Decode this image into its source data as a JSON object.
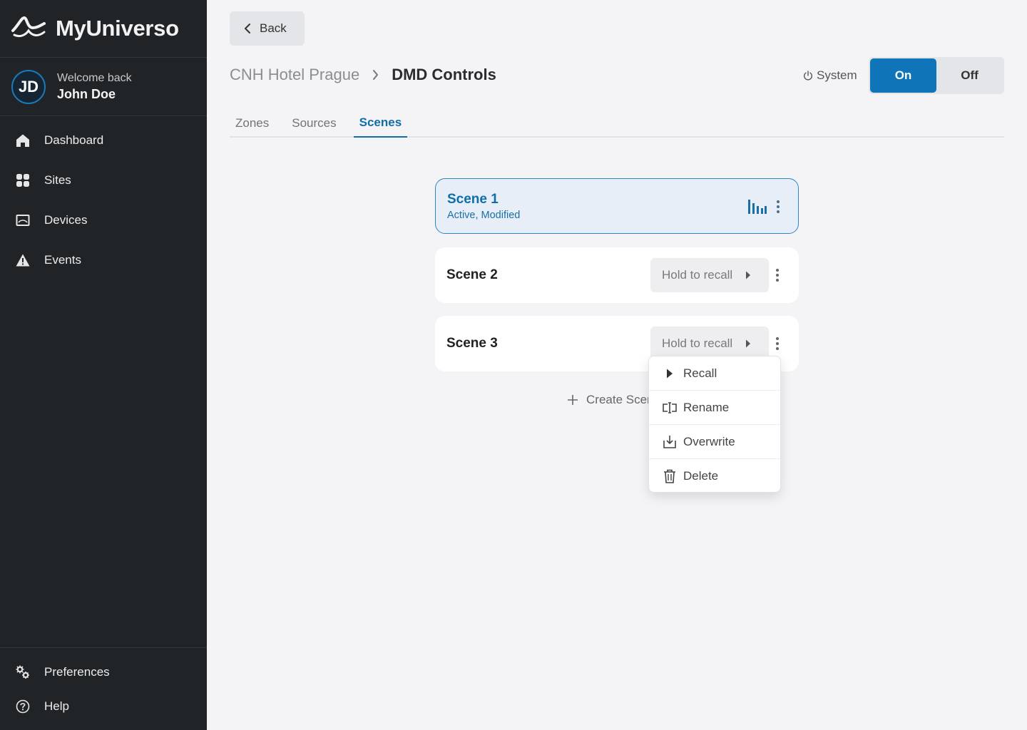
{
  "brand": {
    "name": "MyUniverso"
  },
  "user": {
    "initials": "JD",
    "welcome": "Welcome back",
    "name": "John Doe"
  },
  "nav": {
    "items": [
      {
        "label": "Dashboard",
        "icon": "home-icon"
      },
      {
        "label": "Sites",
        "icon": "grid-icon"
      },
      {
        "label": "Devices",
        "icon": "device-icon"
      },
      {
        "label": "Events",
        "icon": "warning-icon"
      }
    ],
    "bottom": [
      {
        "label": "Preferences",
        "icon": "gears-icon"
      },
      {
        "label": "Help",
        "icon": "help-icon"
      }
    ]
  },
  "header": {
    "back_label": "Back",
    "breadcrumb": [
      "CNH Hotel Prague",
      "DMD Controls"
    ],
    "system_label": "System",
    "toggle": {
      "on": "On",
      "off": "Off",
      "selected": "On"
    }
  },
  "tabs": [
    {
      "label": "Zones",
      "active": false
    },
    {
      "label": "Sources",
      "active": false
    },
    {
      "label": "Scenes",
      "active": true
    }
  ],
  "scenes": [
    {
      "name": "Scene 1",
      "status": "Active, Modified",
      "active": true
    },
    {
      "name": "Scene 2",
      "recall_label": "Hold to recall",
      "active": false
    },
    {
      "name": "Scene 3",
      "recall_label": "Hold to recall",
      "active": false
    }
  ],
  "create_label": "Create Scene",
  "context_menu": {
    "items": [
      {
        "label": "Recall",
        "icon": "play-icon"
      },
      {
        "label": "Rename",
        "icon": "rename-icon"
      },
      {
        "label": "Overwrite",
        "icon": "download-icon"
      },
      {
        "label": "Delete",
        "icon": "trash-icon"
      }
    ]
  },
  "colors": {
    "accent": "#0f75b8",
    "sidebar_bg": "#212427",
    "page_bg": "#f4f4f6"
  }
}
